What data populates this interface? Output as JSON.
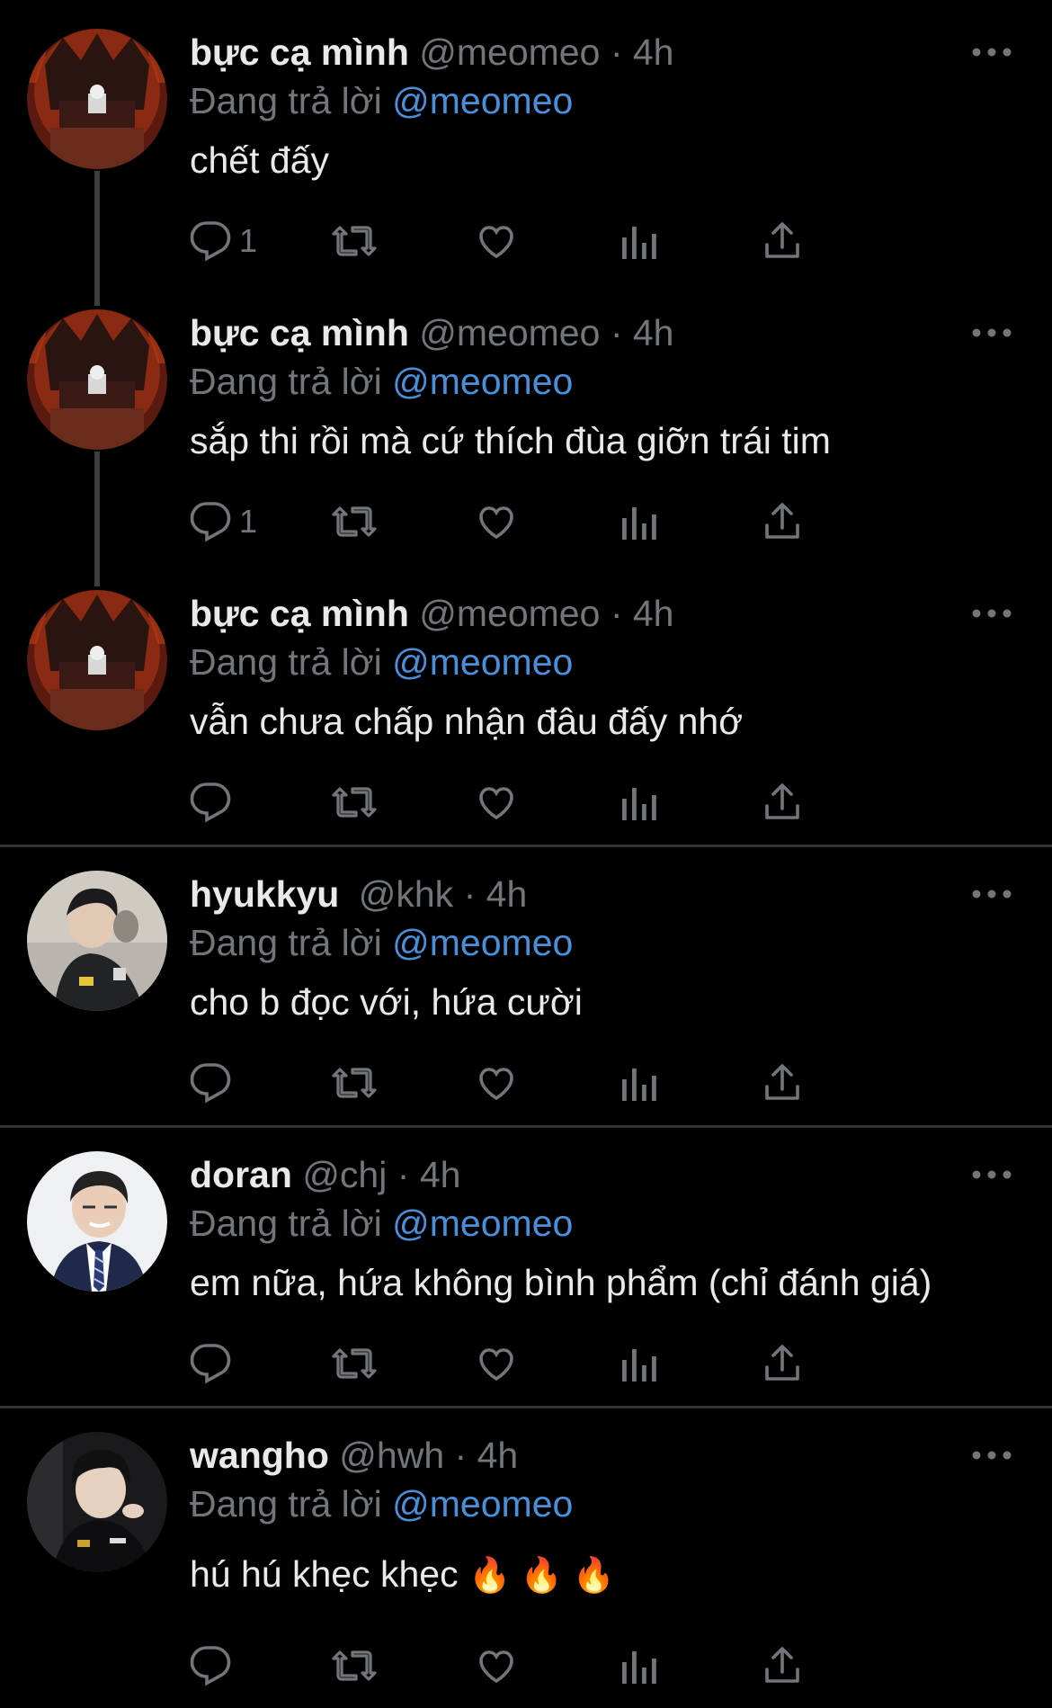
{
  "reply_prefix": "Đang trả lời",
  "tweets": [
    {
      "name": "bực cạ mình",
      "handle": "@meomeo",
      "sep": "·",
      "time": "4h",
      "reply_to": "@meomeo",
      "text": "chết đấy",
      "reply_count": "1"
    },
    {
      "name": "bực cạ mình",
      "handle": "@meomeo",
      "sep": "·",
      "time": "4h",
      "reply_to": "@meomeo",
      "text": "sắp thi rồi mà cứ thích đùa giỡn trái tim",
      "reply_count": "1"
    },
    {
      "name": "bực cạ mình",
      "handle": "@meomeo",
      "sep": "·",
      "time": "4h",
      "reply_to": "@meomeo",
      "text": "vẫn chưa chấp nhận đâu đấy nhớ",
      "reply_count": ""
    },
    {
      "name": "hyukkyu",
      "handle": "@khk",
      "sep": "·",
      "time": "4h",
      "reply_to": "@meomeo",
      "text": "cho b đọc với, hứa cười",
      "reply_count": ""
    },
    {
      "name": "doran",
      "handle": "@chj",
      "sep": "·",
      "time": "4h",
      "reply_to": "@meomeo",
      "text": "em nữa, hứa không bình phẩm (chỉ đánh giá)",
      "reply_count": ""
    },
    {
      "name": "wangho",
      "handle": "@hwh",
      "sep": "·",
      "time": "4h",
      "reply_to": "@meomeo",
      "text": "hú hú khẹc khẹc",
      "emoji": "🔥 🔥 🔥",
      "reply_count": ""
    }
  ],
  "icons": {
    "reply": "reply-icon",
    "retweet": "retweet-icon",
    "like": "like-icon",
    "views": "views-icon",
    "share": "share-icon",
    "more": "more-icon"
  },
  "colors": {
    "background": "#000000",
    "text": "#e7e9ea",
    "muted": "#71767b",
    "mention": "#4a8fd9",
    "divider": "#2f3336"
  }
}
